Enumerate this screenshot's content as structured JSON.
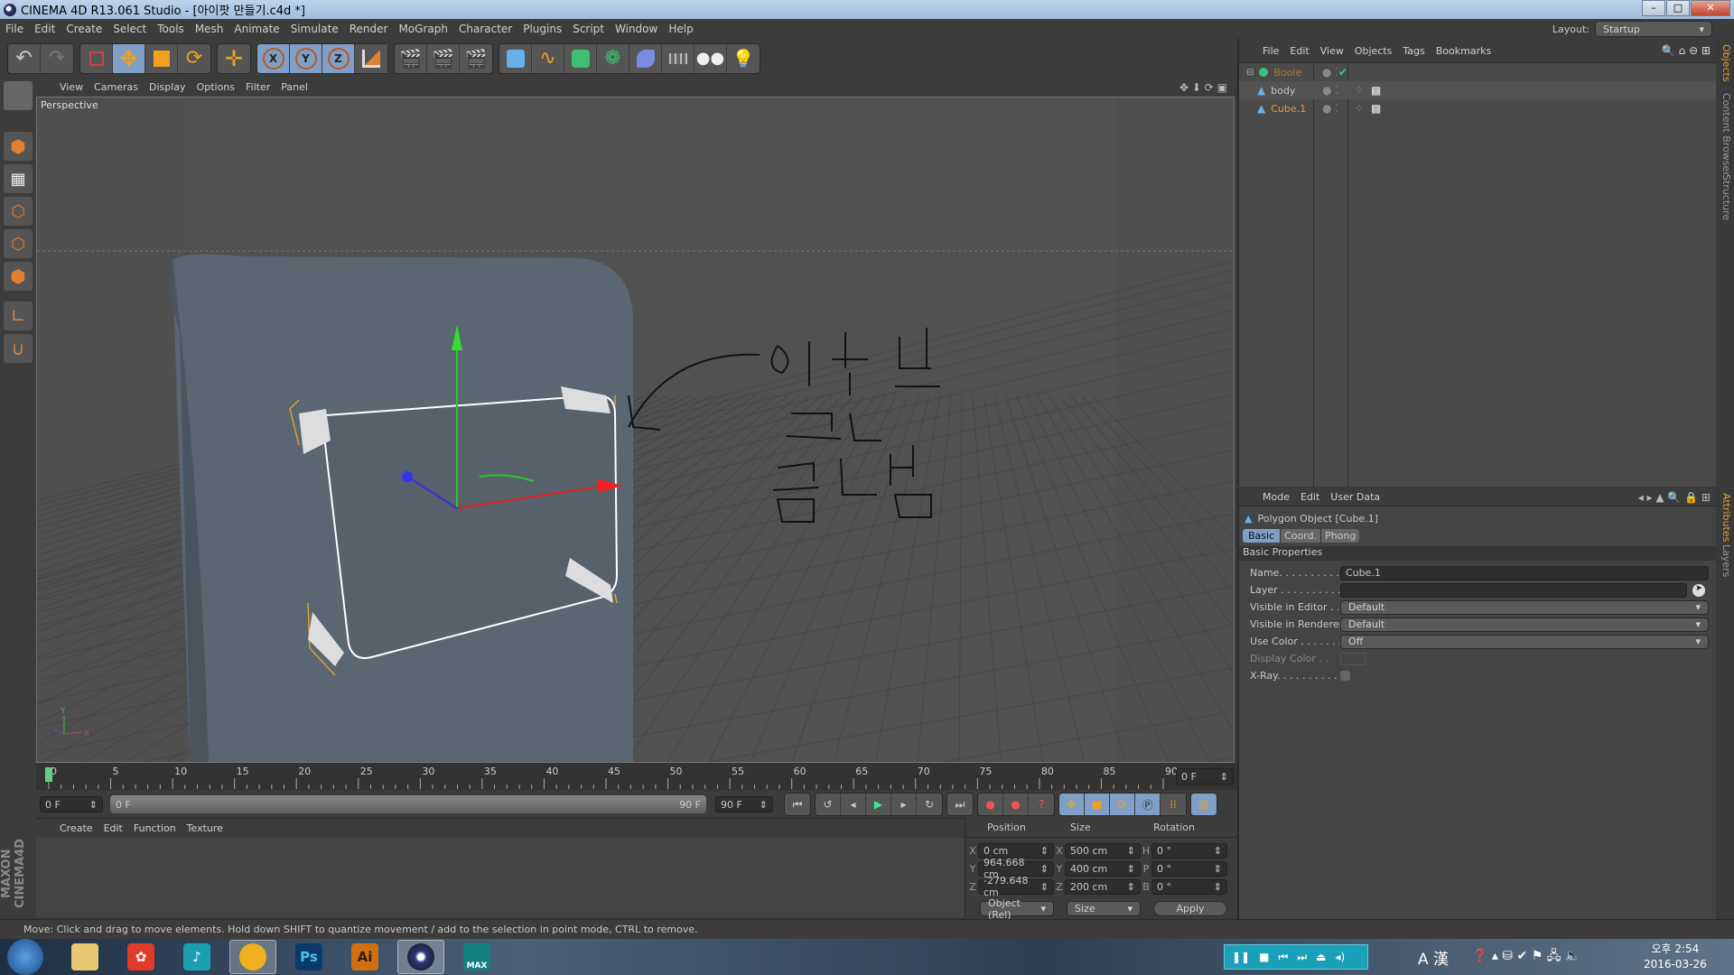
{
  "window": {
    "title": "CINEMA 4D R13.061 Studio - [아이팟 만들기.c4d *]"
  },
  "menu": [
    "File",
    "Edit",
    "Create",
    "Select",
    "Tools",
    "Mesh",
    "Animate",
    "Simulate",
    "Render",
    "MoGraph",
    "Character",
    "Plugins",
    "Script",
    "Window",
    "Help"
  ],
  "layout": {
    "label": "Layout:",
    "value": "Startup"
  },
  "toolbar": {
    "icons": [
      "undo-icon",
      "redo-icon",
      "live-selection-icon",
      "move-icon",
      "scale-icon",
      "rotate-icon",
      "add-icon",
      "x-axis-icon",
      "y-axis-icon",
      "z-axis-icon",
      "coordinate-system-icon",
      "render-view-icon",
      "render-picture-viewer-icon",
      "render-settings-icon",
      "cube-icon",
      "spline-icon",
      "nurbs-icon",
      "array-icon",
      "deformer-icon",
      "floor-icon",
      "camera-icon",
      "light-icon"
    ]
  },
  "left_tools": [
    "model-mode-icon",
    "texture-mode-icon",
    "points-mode-icon",
    "edges-mode-icon",
    "polygons-mode-icon",
    "axis-mode-icon",
    "magnet-icon"
  ],
  "brand": "MAXON CINEMA 4D",
  "viewport": {
    "menu": [
      "View",
      "Cameras",
      "Display",
      "Options",
      "Filter",
      "Panel"
    ],
    "label": "Perspective"
  },
  "timeline": {
    "ticks": [
      "0",
      "5",
      "10",
      "15",
      "20",
      "25",
      "30",
      "35",
      "40",
      "45",
      "50",
      "55",
      "60",
      "65",
      "70",
      "75",
      "80",
      "85",
      "90"
    ],
    "current": "0 F",
    "start": "0 F",
    "range_start": "0 F",
    "range_end": "90 F",
    "end": "90 F",
    "accent": "#5fd08a"
  },
  "materials": {
    "menu": [
      "Create",
      "Edit",
      "Function",
      "Texture"
    ]
  },
  "coords": {
    "headers": [
      "Position",
      "Size",
      "Rotation"
    ],
    "rows": [
      {
        "a": "X",
        "pos": "0 cm",
        "s": "X",
        "size": "500 cm",
        "r": "H",
        "rot": "0 °"
      },
      {
        "a": "Y",
        "pos": "964.668 cm",
        "s": "Y",
        "size": "400 cm",
        "r": "P",
        "rot": "0 °"
      },
      {
        "a": "Z",
        "pos": "-279.648 cm",
        "s": "Z",
        "size": "200 cm",
        "r": "B",
        "rot": "0 °"
      }
    ],
    "mode": "Object (Rel)",
    "size_mode": "Size",
    "apply": "Apply"
  },
  "objects": {
    "menu": [
      "File",
      "Edit",
      "View",
      "Objects",
      "Tags",
      "Bookmarks"
    ],
    "items": [
      {
        "name": "Boole",
        "color": "#b07a30"
      },
      {
        "name": "body",
        "color": "#c8c8c8"
      },
      {
        "name": "Cube.1",
        "color": "#e0a030"
      }
    ]
  },
  "attributes": {
    "menu": [
      "Mode",
      "Edit",
      "User Data"
    ],
    "object": "Polygon Object [Cube.1]",
    "tabs": [
      "Basic",
      "Coord.",
      "Phong"
    ],
    "section": "Basic Properties",
    "fields": [
      {
        "label": "Name. . . . . . . . . . .",
        "value": "Cube.1"
      },
      {
        "label": "Layer . . . . . . . . . . .",
        "value": ""
      },
      {
        "label": "Visible in Editor . .",
        "value": "Default"
      },
      {
        "label": "Visible in Renderer",
        "value": "Default"
      },
      {
        "label": "Use Color . . . . . . .",
        "value": "Off"
      },
      {
        "label": "Display Color . .",
        "value": ""
      },
      {
        "label": "X-Ray. . . . . . . . . . .",
        "value": ""
      }
    ]
  },
  "side_tabs": {
    "top": [
      "Objects",
      "Content Browser",
      "Structure"
    ],
    "bottom": [
      "Attributes",
      "Layers"
    ]
  },
  "status": "Move: Click and drag to move elements. Hold down SHIFT to quantize movement / add to the selection in point mode, CTRL to remove.",
  "taskbar": {
    "apps": [
      {
        "name": "explorer"
      },
      {
        "name": "gom"
      },
      {
        "name": "music"
      },
      {
        "name": "chrome"
      },
      {
        "name": "Ps",
        "label": "Ps"
      },
      {
        "name": "Ai",
        "label": "Ai"
      },
      {
        "name": "cinema4d"
      },
      {
        "name": "3dsmax",
        "label": "MAX"
      }
    ],
    "tray": {
      "ime": "A 漢",
      "time": "오후 2:54",
      "date": "2016-03-26"
    }
  }
}
